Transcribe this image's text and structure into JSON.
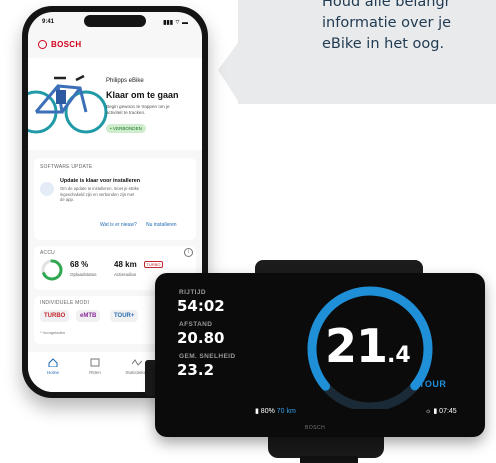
{
  "bubble": {
    "line1": "Houd alle belangr",
    "line2": "informatie over je",
    "line3": "eBike in het oog."
  },
  "phone": {
    "status_time": "9:41",
    "status_icons": "▮▮▮ ⌔ ▬",
    "brand": "BOSCH",
    "bike": {
      "name": "Philipps eBike",
      "title": "Klaar om te gaan",
      "subtitle_1": "Begin gewoon te trappen om je",
      "subtitle_2": "activiteit te tracken.",
      "badge": "• VERBONDEN"
    },
    "software_update": {
      "label": "SOFTWARE UPDATE",
      "title": "Update is klaar voor installeren",
      "body_1": "Om de update te installeren, moet je eBike",
      "body_2": "ingeschakeld zijn en verbonden zijn met",
      "body_3": "de app.",
      "link_new": "Wat is er nieuw?",
      "link_install": "Nu installeren"
    },
    "battery": {
      "label": "ACCU",
      "percent": "68 %",
      "percent_label": "Oplaadstatus",
      "range": "48 km",
      "range_label": "Actieradius",
      "range_mode": "TURBO",
      "level": 0.68
    },
    "modes": {
      "label": "INDIVIDUELE MODI",
      "items": [
        "TURBO",
        "eMTB",
        "TOUR+"
      ],
      "footnote": "* Voorgeladen"
    },
    "tabs": [
      {
        "label": "Home"
      },
      {
        "label": "Ritten"
      },
      {
        "label": "Statistieken"
      }
    ]
  },
  "display": {
    "trip_time_label": "RIJTIJD",
    "trip_time": "54:02",
    "distance_label": "AFSTAND",
    "distance": "20.80",
    "avg_speed_label": "GEM. SNELHEID",
    "avg_speed": "23.2",
    "speed_int": "21",
    "speed_dec": ".4",
    "mode": "TOUR",
    "battery_pct": "80%",
    "range": "70 km",
    "clock": "07:45",
    "brand": "BOSCH",
    "gauge_level": 0.72,
    "accent": "#1f8fd8"
  }
}
